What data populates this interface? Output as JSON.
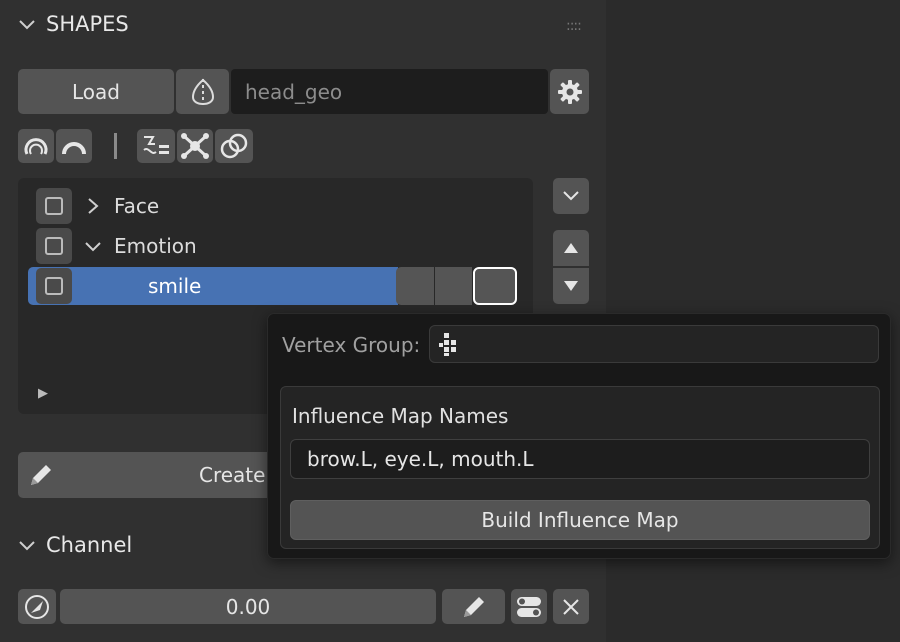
{
  "shapes_panel": {
    "title": "SHAPES",
    "load_button": "Load",
    "mesh_field_value": "head_geo",
    "tree": [
      {
        "label": "Face",
        "expanded": false
      },
      {
        "label": "Emotion",
        "expanded": true
      },
      {
        "label": "smile",
        "selected": true
      }
    ],
    "create_button": "Create"
  },
  "channel_panel": {
    "title": "Channel",
    "value": "0.00"
  },
  "popup": {
    "vertex_group_label": "Vertex Group:",
    "influence_title": "Influence Map Names",
    "influence_value": "brow.L, eye.L, mouth.L",
    "build_button": "Build Influence Map"
  },
  "colors": {
    "selection_blue": "#4772b3",
    "panel_bg": "#303030",
    "popup_bg": "#181818"
  },
  "icons": [
    "chevron-down-icon",
    "grip-icon",
    "symmetry-icon",
    "gear-icon",
    "shape-key-icon",
    "wire-icon",
    "node-icon",
    "overlap-icon",
    "pencil-icon",
    "drag-icon",
    "toggle-icon",
    "close-icon",
    "vertex-group-icon"
  ]
}
